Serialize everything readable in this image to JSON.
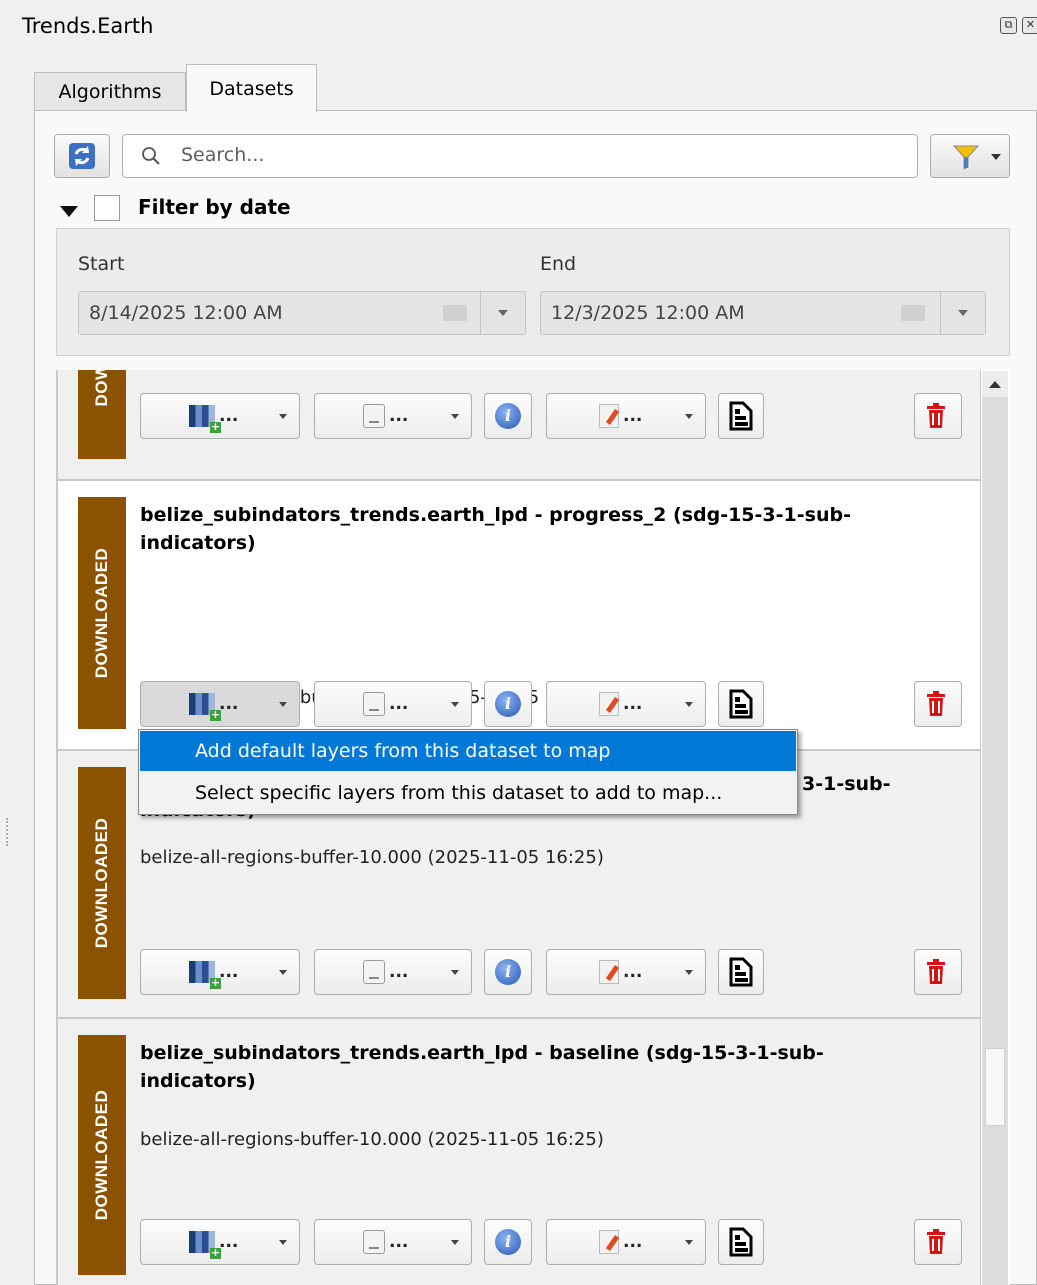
{
  "window": {
    "title": "Trends.Earth",
    "float_icon": "float-icon",
    "close_icon": "close-icon"
  },
  "tabs": [
    {
      "label": "Algorithms",
      "active": false
    },
    {
      "label": "Datasets",
      "active": true
    }
  ],
  "toolbar": {
    "search_placeholder": "Search...",
    "refresh_icon": "refresh-icon",
    "filter_icon": "funnel-filter-icon"
  },
  "date_filter": {
    "label": "Filter by date",
    "checked": false,
    "start_label": "Start",
    "start_value": "8/14/2025 12:00 AM",
    "end_label": "End",
    "end_value": "12/3/2025 12:00 AM"
  },
  "colors": {
    "status_bar": "#8b5200",
    "menu_highlight": "#0078d7"
  },
  "datasets": [
    {
      "status": "DOWNLOADED",
      "status_visible": "DOW",
      "title": "",
      "subtitle": ""
    },
    {
      "status": "DOWNLOADED",
      "title": "belize_subindators_trends.earth_lpd - progress_2 (sdg-15-3-1-sub-indicators)",
      "subtitle": "belize-all-regions-buffer-10.000 (2025-11-05 16:25)"
    },
    {
      "status": "DOWNLOADED",
      "title_visible_tail": "3-1-sub-",
      "title_visible_line2": "indicators)",
      "subtitle": "belize-all-regions-buffer-10.000 (2025-11-05 16:25)"
    },
    {
      "status": "DOWNLOADED",
      "title": "belize_subindators_trends.earth_lpd - baseline (sdg-15-3-1-sub-indicators)",
      "subtitle": "belize-all-regions-buffer-10.000 (2025-11-05 16:25)"
    }
  ],
  "card_buttons": {
    "add_layer_label": "...",
    "report_label": "...",
    "edit_label": "..."
  },
  "context_menu": {
    "items": [
      {
        "label": "Add default layers from this dataset to map",
        "highlighted": true
      },
      {
        "label": "Select specific layers from this dataset to add to map...",
        "highlighted": false
      }
    ]
  }
}
